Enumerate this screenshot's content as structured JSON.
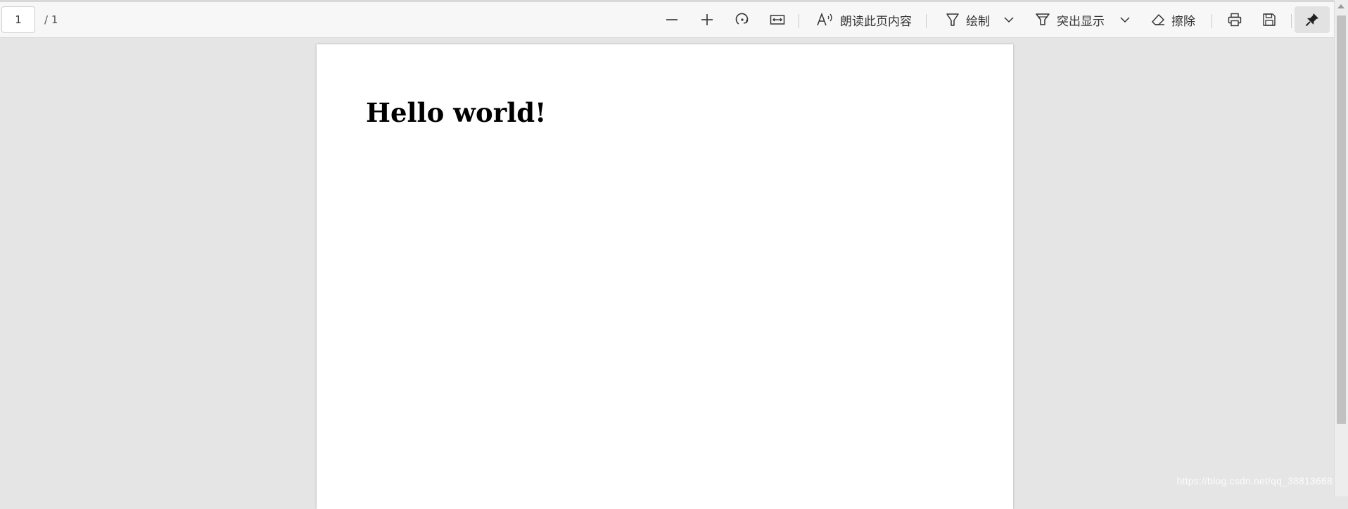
{
  "toolbar": {
    "page_current": "1",
    "page_total": "/ 1",
    "zoom_out": "zoom-out",
    "zoom_in": "zoom-in",
    "rotate": "rotate",
    "fit": "fit-to-page",
    "read_aloud_label": "朗读此页内容",
    "draw_label": "绘制",
    "highlight_label": "突出显示",
    "erase_label": "擦除"
  },
  "document": {
    "heading": "Hello world!"
  },
  "watermark": "https://blog.csdn.net/qq_38813668",
  "icons": [
    "minus-icon",
    "plus-icon",
    "rotate-icon",
    "fit-width-icon",
    "read-aloud-icon",
    "draw-icon",
    "chevron-down-icon",
    "highlight-icon",
    "eraser-icon",
    "print-icon",
    "save-icon",
    "pin-icon"
  ]
}
